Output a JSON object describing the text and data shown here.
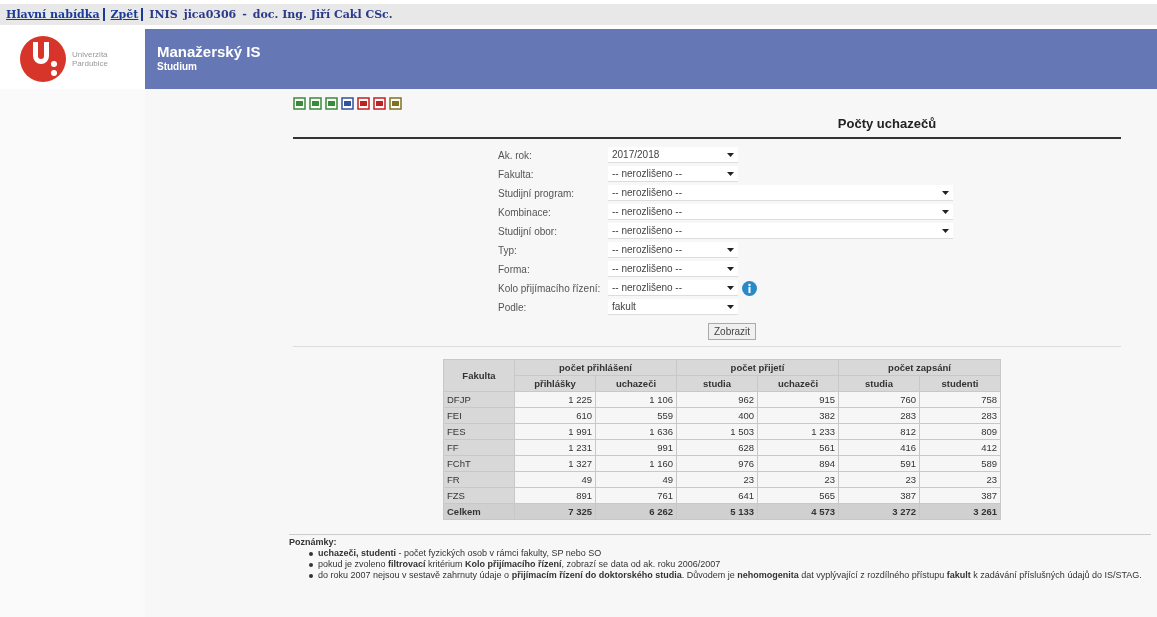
{
  "top_bar": {
    "links": [
      "Hlavní nabídka",
      "Zpět"
    ],
    "app": "INIS",
    "user_id": "jica0306",
    "separator": "-",
    "user_name": "doc. Ing. Jiří Cakl CSc."
  },
  "header": {
    "logo_text": [
      "Univerzita",
      "Pardubice"
    ],
    "title": "Manažerský IS",
    "subtitle": "Studium"
  },
  "page_title": "Počty uchazečů",
  "filters": [
    {
      "label": "Ak. rok:",
      "value": "2017/2018",
      "wide": false,
      "info": false
    },
    {
      "label": "Fakulta:",
      "value": "-- nerozlišeno --",
      "wide": false,
      "info": false
    },
    {
      "label": "Studijní program:",
      "value": "-- nerozlišeno --",
      "wide": true,
      "info": false
    },
    {
      "label": "Kombinace:",
      "value": "-- nerozlišeno --",
      "wide": true,
      "info": false
    },
    {
      "label": "Studijní obor:",
      "value": "-- nerozlišeno --",
      "wide": true,
      "info": false
    },
    {
      "label": "Typ:",
      "value": "-- nerozlišeno --",
      "wide": false,
      "info": false
    },
    {
      "label": "Forma:",
      "value": "-- nerozlišeno --",
      "wide": false,
      "info": false
    },
    {
      "label": "Kolo přijímacího řízení:",
      "value": "-- nerozlišeno --",
      "wide": false,
      "info": true
    },
    {
      "label": "Podle:",
      "value": "fakult",
      "wide": false,
      "info": false
    }
  ],
  "submit": "Zobrazit",
  "table": {
    "corner": "Fakulta",
    "groups": [
      "počet přihlášení",
      "počet přijetí",
      "počet zapsání"
    ],
    "columns": [
      "přihlášky",
      "uchazeči",
      "studia",
      "uchazeči",
      "studia",
      "studenti"
    ],
    "rows": [
      {
        "name": "DFJP",
        "values": [
          "1 225",
          "1 106",
          "962",
          "915",
          "760",
          "758"
        ]
      },
      {
        "name": "FEI",
        "values": [
          "610",
          "559",
          "400",
          "382",
          "283",
          "283"
        ]
      },
      {
        "name": "FES",
        "values": [
          "1 991",
          "1 636",
          "1 503",
          "1 233",
          "812",
          "809"
        ]
      },
      {
        "name": "FF",
        "values": [
          "1 231",
          "991",
          "628",
          "561",
          "416",
          "412"
        ]
      },
      {
        "name": "FChT",
        "values": [
          "1 327",
          "1 160",
          "976",
          "894",
          "591",
          "589"
        ]
      },
      {
        "name": "FR",
        "values": [
          "49",
          "49",
          "23",
          "23",
          "23",
          "23"
        ]
      },
      {
        "name": "FZS",
        "values": [
          "891",
          "761",
          "641",
          "565",
          "387",
          "387"
        ]
      }
    ],
    "total": {
      "name": "Celkem",
      "values": [
        "7 325",
        "6 262",
        "5 133",
        "4 573",
        "3 272",
        "3 261"
      ]
    }
  },
  "notes": {
    "title": "Poznámky:",
    "items": [
      "**uchazeči, studenti** - počet fyzických osob v rámci fakulty, SP nebo SO",
      "pokud je zvoleno **filtrovací** kritérium **Kolo přijímacího řízení**, zobrazí se data od ak. roku 2006/2007",
      "do roku 2007 nejsou v sestavě zahrnuty údaje o **přijímacím řízení do doktorského studia**. Důvodem je **nehomogenita** dat vyplývající z rozdílného přístupu **fakult** k zadávání příslušných údajů do IS/STAG."
    ]
  }
}
